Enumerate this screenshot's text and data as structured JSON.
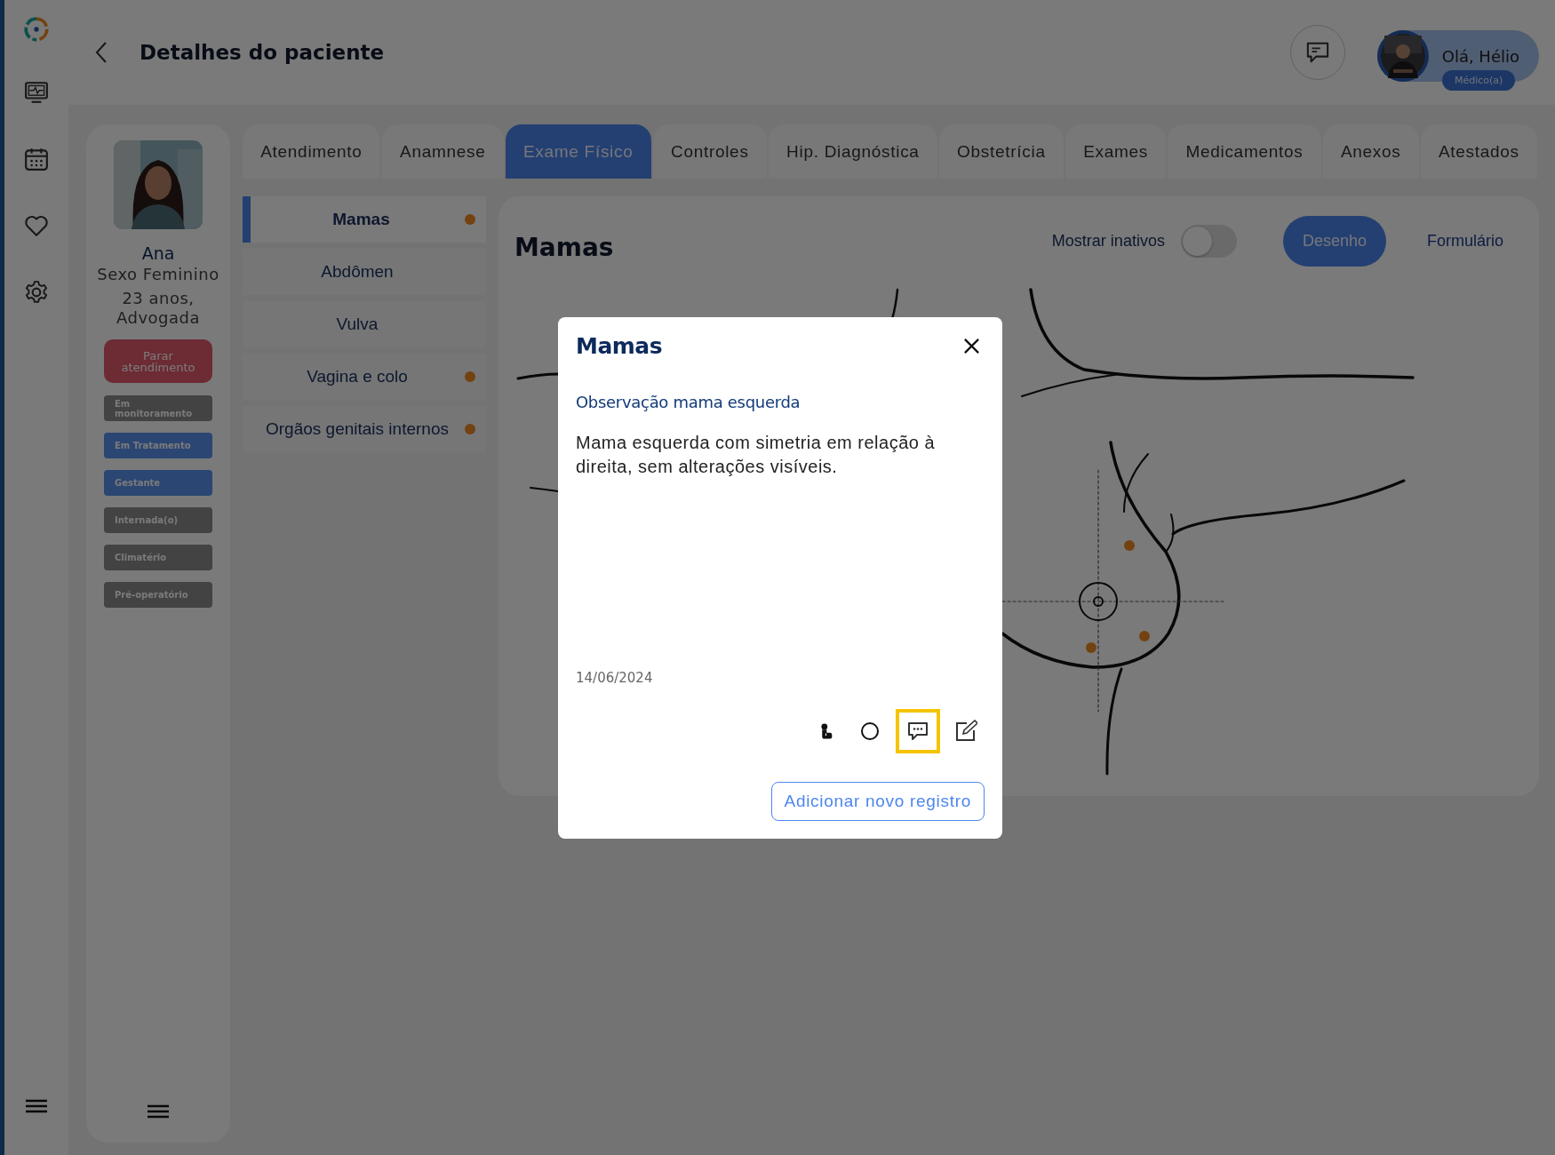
{
  "header": {
    "title": "Detalhes do paciente",
    "user": {
      "greeting": "Olá, Hélio",
      "role": "Médico(a)"
    }
  },
  "patient": {
    "name": "Ana",
    "sex": "Sexo Feminino",
    "info": "23 anos, Advogada",
    "stop_button": "Parar atendimento",
    "tags": [
      {
        "label": "Em monitoramento",
        "active": false
      },
      {
        "label": "Em Tratamento",
        "active": true
      },
      {
        "label": "Gestante",
        "active": true
      },
      {
        "label": "Internada(o)",
        "active": false
      },
      {
        "label": "Climatério",
        "active": false
      },
      {
        "label": "Pré-operatório",
        "active": false
      }
    ]
  },
  "tabs": [
    {
      "label": "Atendimento",
      "selected": false
    },
    {
      "label": "Anamnese",
      "selected": false
    },
    {
      "label": "Exame Físico",
      "selected": true
    },
    {
      "label": "Controles",
      "selected": false
    },
    {
      "label": "Hip. Diagnóstica",
      "selected": false
    },
    {
      "label": "Obstetrícia",
      "selected": false
    },
    {
      "label": "Exames",
      "selected": false
    },
    {
      "label": "Medicamentos",
      "selected": false
    },
    {
      "label": "Anexos",
      "selected": false
    },
    {
      "label": "Atestados",
      "selected": false
    }
  ],
  "sections": [
    {
      "label": "Mamas",
      "selected": true,
      "flagged": true
    },
    {
      "label": "Abdômen",
      "selected": false,
      "flagged": false
    },
    {
      "label": "Vulva",
      "selected": false,
      "flagged": false
    },
    {
      "label": "Vagina e colo",
      "selected": false,
      "flagged": true
    },
    {
      "label": "Orgãos genitais internos",
      "selected": false,
      "flagged": true
    }
  ],
  "panel": {
    "title": "Mamas",
    "show_inactive": {
      "label": "Mostrar inativos",
      "on": false
    },
    "views": [
      {
        "label": "Desenho",
        "selected": true
      },
      {
        "label": "Formulário",
        "selected": false
      }
    ]
  },
  "modal": {
    "title": "Mamas",
    "subtitle": "Observação mama esquerda",
    "text": "Mama esquerda com simetria em relação à direita, sem alterações visíveis.",
    "date": "14/06/2024",
    "tools": [
      {
        "kind": "pointer",
        "selected": false
      },
      {
        "kind": "circle",
        "selected": false
      },
      {
        "kind": "comment",
        "selected": true
      },
      {
        "kind": "edit",
        "selected": false
      }
    ],
    "add_button": "Adicionar novo registro"
  }
}
